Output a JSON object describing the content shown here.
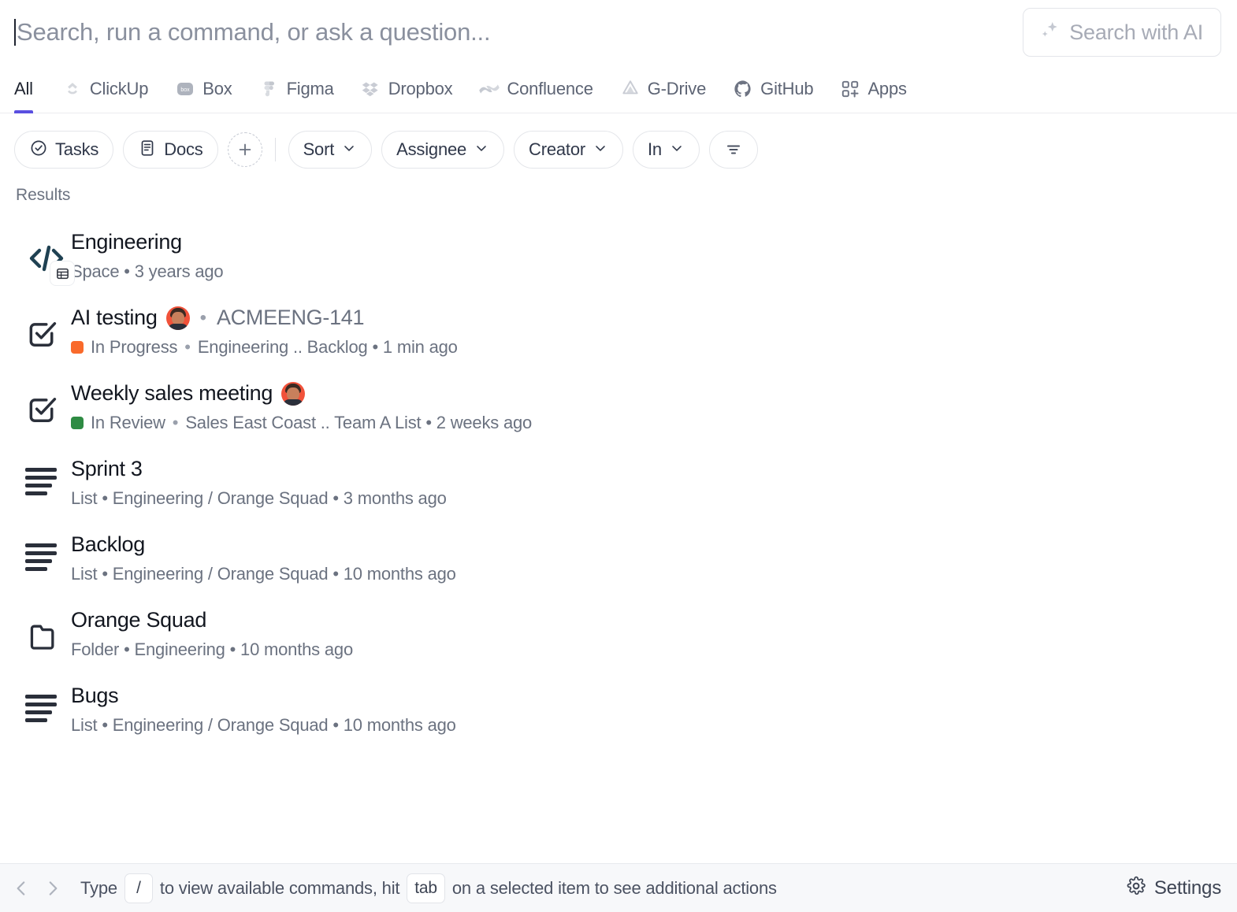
{
  "search": {
    "placeholder": "Search, run a command, or ask a question...",
    "value": "",
    "ai_button_label": "Search with AI"
  },
  "tabs": [
    {
      "label": "All",
      "icon": "none",
      "active": true
    },
    {
      "label": "ClickUp",
      "icon": "clickup-icon",
      "active": false
    },
    {
      "label": "Box",
      "icon": "box-icon",
      "active": false
    },
    {
      "label": "Figma",
      "icon": "figma-icon",
      "active": false
    },
    {
      "label": "Dropbox",
      "icon": "dropbox-icon",
      "active": false
    },
    {
      "label": "Confluence",
      "icon": "confluence-icon",
      "active": false
    },
    {
      "label": "G-Drive",
      "icon": "gdrive-icon",
      "active": false
    },
    {
      "label": "GitHub",
      "icon": "github-icon",
      "active": false
    },
    {
      "label": "Apps",
      "icon": "apps-icon",
      "active": false
    }
  ],
  "filters": {
    "tasks_label": "Tasks",
    "docs_label": "Docs",
    "add_label": "+",
    "sort_label": "Sort",
    "assignee_label": "Assignee",
    "creator_label": "Creator",
    "in_label": "In"
  },
  "results": {
    "section_label": "Results",
    "items": [
      {
        "title": "Engineering",
        "icon": "space-code-icon",
        "badge": "table-icon",
        "avatar": false,
        "id_text": "",
        "status": "",
        "status_color": "",
        "meta": "Space • 3 years ago"
      },
      {
        "title": "AI testing",
        "icon": "task-check-icon",
        "badge": "",
        "avatar": true,
        "id_text": "ACMEENG-141",
        "status": "In Progress",
        "status_color": "#F96A2B",
        "meta": "Engineering .. Backlog • 1 min ago"
      },
      {
        "title": "Weekly sales meeting",
        "icon": "task-check-icon",
        "badge": "",
        "avatar": true,
        "id_text": "",
        "status": "In Review",
        "status_color": "#2E8B43",
        "meta": "Sales East Coast .. Team A List • 2 weeks ago"
      },
      {
        "title": "Sprint 3",
        "icon": "list-icon",
        "badge": "",
        "avatar": false,
        "id_text": "",
        "status": "",
        "status_color": "",
        "meta": "List • Engineering / Orange Squad • 3 months ago"
      },
      {
        "title": "Backlog",
        "icon": "list-icon",
        "badge": "",
        "avatar": false,
        "id_text": "",
        "status": "",
        "status_color": "",
        "meta": "List • Engineering / Orange Squad • 10 months ago"
      },
      {
        "title": "Orange Squad",
        "icon": "folder-icon",
        "badge": "",
        "avatar": false,
        "id_text": "",
        "status": "",
        "status_color": "",
        "meta": "Folder • Engineering • 10 months ago"
      },
      {
        "title": "Bugs",
        "icon": "list-icon",
        "badge": "",
        "avatar": false,
        "id_text": "",
        "status": "",
        "status_color": "",
        "meta": "List • Engineering / Orange Squad • 10 months ago"
      }
    ]
  },
  "footer": {
    "hint_part1": "Type",
    "key_slash": "/",
    "hint_part2": "to view available commands, hit",
    "key_tab": "tab",
    "hint_part3": "on a selected item to see additional actions",
    "settings_label": "Settings"
  },
  "colors": {
    "accent": "#5A4FE0",
    "text_primary": "#12161F",
    "text_muted": "#6B7280",
    "icon_dark": "#2A2F3A",
    "space_navy": "#1F4152",
    "footer_bg": "#F7F8FA"
  }
}
